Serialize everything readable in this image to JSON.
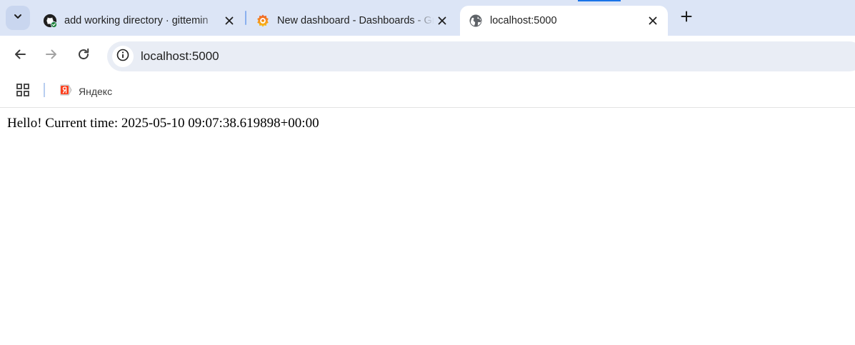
{
  "browser": {
    "tabs": [
      {
        "title": "add working directory · gittemin",
        "favicon": "github-icon",
        "active": false
      },
      {
        "title": "New dashboard - Dashboards - Grafana",
        "favicon": "grafana-icon",
        "active": false
      },
      {
        "title": "localhost:5000",
        "favicon": "globe-icon",
        "active": true
      }
    ],
    "address_bar": {
      "url": "localhost:5000",
      "site_info_icon": "info-icon"
    },
    "bookmarks": [
      {
        "label": "Яндекс",
        "icon": "yandex-icon"
      }
    ],
    "colors": {
      "tabstrip": "#dce5f6",
      "omnibox": "#e9edf5",
      "accent": "#1a73e8"
    }
  },
  "page": {
    "text": "Hello! Current time: 2025-05-10 09:07:38.619898+00:00"
  }
}
